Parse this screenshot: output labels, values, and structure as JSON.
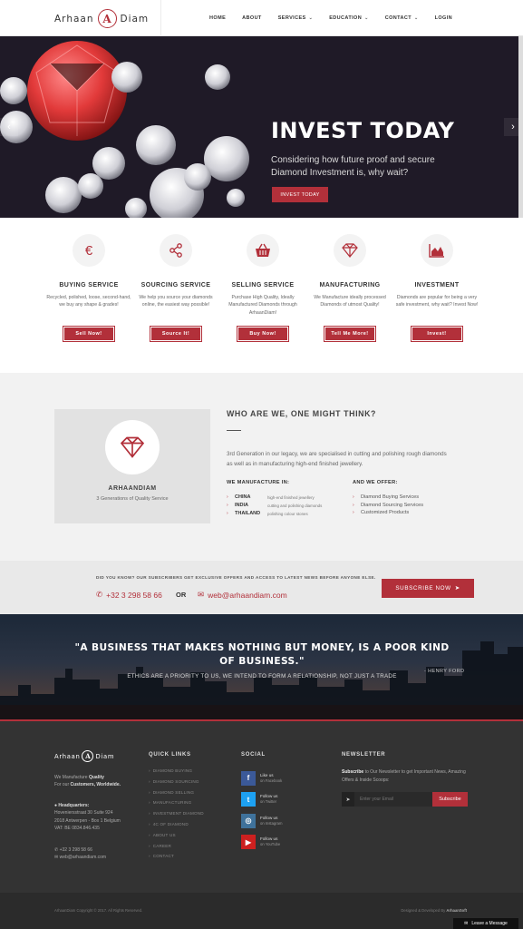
{
  "header": {
    "logo_left": "Arhaan",
    "logo_mark": "A",
    "logo_right": "Diam",
    "nav": [
      {
        "label": "HOME",
        "dropdown": false
      },
      {
        "label": "ABOUT",
        "dropdown": false
      },
      {
        "label": "SERVICES",
        "dropdown": true
      },
      {
        "label": "EDUCATION",
        "dropdown": true
      },
      {
        "label": "CONTACT",
        "dropdown": true
      },
      {
        "label": "LOGIN",
        "dropdown": false
      }
    ]
  },
  "hero": {
    "title": "INVEST TODAY",
    "subtitle": "Considering how future proof and secure Diamond Investment is, why wait?",
    "button": "INVEST TODAY",
    "prev_icon": "‹",
    "next_icon": "›"
  },
  "services": [
    {
      "icon": "euro-icon",
      "glyph": "€",
      "title": "BUYING SERVICE",
      "desc": "Recycled, polished, loose, second-hand, we buy any shape & grades!",
      "button": "Sell Now!"
    },
    {
      "icon": "share-icon",
      "glyph": "share",
      "title": "SOURCING SERVICE",
      "desc": "We help you source your diamonds online, the easiest way possible!",
      "button": "Source It!"
    },
    {
      "icon": "basket-icon",
      "glyph": "basket",
      "title": "SELLING SERVICE",
      "desc": "Purchase High Quality, Ideally Manufactured Diamonds through ArhaanDiam!",
      "button": "Buy Now!"
    },
    {
      "icon": "diamond-icon",
      "glyph": "diamond",
      "title": "MANUFACTURING",
      "desc": "We Manufacture ideally processed Diamonds of utmost Quality!",
      "button": "Tell Me More!"
    },
    {
      "icon": "area-chart-icon",
      "glyph": "chart",
      "title": "INVESTMENT",
      "desc": "Diamonds are popular for being a very safe investment, why wait? Invest Now!",
      "button": "Invest!"
    }
  ],
  "about": {
    "card_name": "ARHAANDIAM",
    "card_tag": "3 Generations of Quality Service",
    "title": "WHO ARE WE, ONE MIGHT THINK?",
    "text": "3rd Generation in our legacy, we are specialised in cutting and polishing rough diamonds as well as in manufacturing high-end finished jewellery.",
    "manufacture_head": "WE MANUFACTURE IN:",
    "manufacture": [
      {
        "country": "CHINA",
        "desc": "high-end finished jewellery"
      },
      {
        "country": "INDIA",
        "desc": "cutting and polishing diamonds"
      },
      {
        "country": "THAILAND",
        "desc": "polishing colour stones"
      }
    ],
    "offer_head": "AND WE OFFER:",
    "offers": [
      "Diamond Buying Services",
      "Diamond Sourcing Services",
      "Customized Products"
    ]
  },
  "contact_strip": {
    "note": "DID YOU KNOW? OUR SUBSCRIBERS GET EXCLUSIVE OFFERS AND ACCESS TO LATEST NEWS BEFORE ANYONE ELSE.",
    "phone": "+32 3 298 58 66",
    "or": "OR",
    "email": "web@arhaandiam.com",
    "button": "SUBSCRIBE NOW"
  },
  "quote": {
    "text": "\"A BUSINESS THAT MAKES NOTHING BUT MONEY, IS A POOR KIND OF BUSINESS.\"",
    "sub": "ETHICS ARE A PRIORITY TO US, WE INTEND TO FORM A RELATIONSHIP, NOT JUST A TRADE",
    "author": "- HENRY FORD"
  },
  "footer": {
    "logo_left": "Arhaan",
    "logo_mark": "A",
    "logo_right": "Diam",
    "about_line1_pre": "We Manufacture ",
    "about_line1_bold": "Quality",
    "about_line2_pre": "For our ",
    "about_line2_bold": "Customers, Worldwide.",
    "hq_label": "Headquarters:",
    "address1": "Hoveniersstraat 30 Suite 924",
    "address2": "2018 Antwerpen - Box 1 Belgium",
    "vat": "VAT: BE 0834.846.435",
    "phone": "+32 3 298 58 66",
    "email": "web@arhaandiam.com",
    "quick_links_head": "QUICK LINKS",
    "quick_links": [
      "DIAMOND BUYING",
      "DIAMOND SOURCING",
      "DIAMOND SELLING",
      "MANUFACTURING",
      "INVESTMENT DIAMOND",
      "4C OF DIAMOND",
      "ABOUT US",
      "CAREER",
      "CONTACT"
    ],
    "social_head": "SOCIAL",
    "social": [
      {
        "icon": "facebook-icon",
        "glyph": "f",
        "color": "#3b5998",
        "label": "Like us",
        "sub": "on Facebook"
      },
      {
        "icon": "twitter-icon",
        "glyph": "t",
        "color": "#1da1f2",
        "label": "Follow us",
        "sub": "on Twitter"
      },
      {
        "icon": "instagram-icon",
        "glyph": "◎",
        "color": "#3f729b",
        "label": "Follow us",
        "sub": "on Instagram"
      },
      {
        "icon": "youtube-icon",
        "glyph": "▶",
        "color": "#cd201f",
        "label": "Follow us",
        "sub": "on YouTube"
      }
    ],
    "newsletter_head": "NEWSLETTER",
    "newsletter_bold": "Subscribe",
    "newsletter_text": " to Our Newsletter to get Important News, Amazing Offers & Inside Scoops:",
    "newsletter_placeholder": "Enter your Email",
    "newsletter_button": "Subscribe",
    "copyright": "ArhaanDiam Copyright © 2017. All Rights Reserved.",
    "credit_pre": "Designed & Developed By ",
    "credit_bold": "ArhaanSoft"
  },
  "chat": {
    "label": "Leave a Message"
  },
  "colors": {
    "accent": "#b2303a",
    "hero_bg": "#1f1a27",
    "footer_bg": "#333333"
  }
}
